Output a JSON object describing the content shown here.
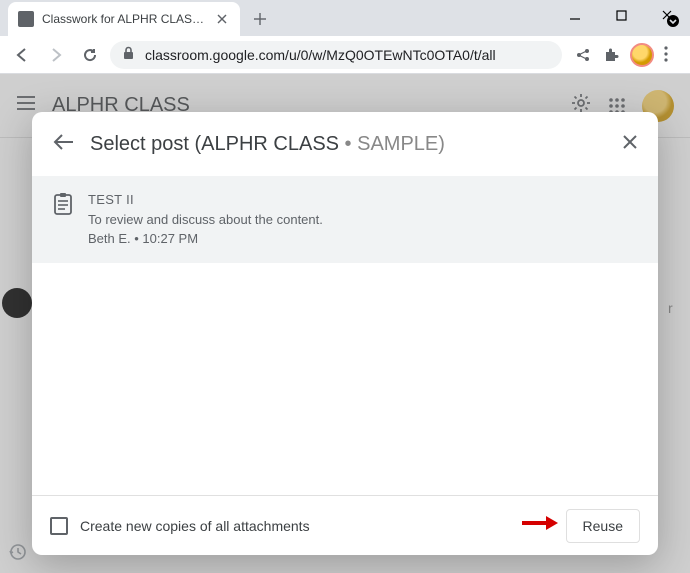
{
  "window": {
    "minimize": "—",
    "maximize": "▢",
    "close": "✕"
  },
  "tab": {
    "title": "Classwork for ALPHR CLASS SAM",
    "close": "✕",
    "new": "+",
    "chevron": "▾"
  },
  "toolbar": {
    "url": "classroom.google.com/u/0/w/MzQ0OTEwNTc0OTA0/t/all",
    "menu": "⋮"
  },
  "app": {
    "title": "ALPHR CLASS"
  },
  "dialog": {
    "title_prefix": "Select post (ALPHR CLASS",
    "title_suffix": " • SAMPLE)",
    "post": {
      "title": "TEST II",
      "desc": "To review and discuss about the content.",
      "meta": "Beth E. • 10:27 PM"
    },
    "checkbox_label": "Create new copies of all attachments",
    "reuse": "Reuse"
  }
}
